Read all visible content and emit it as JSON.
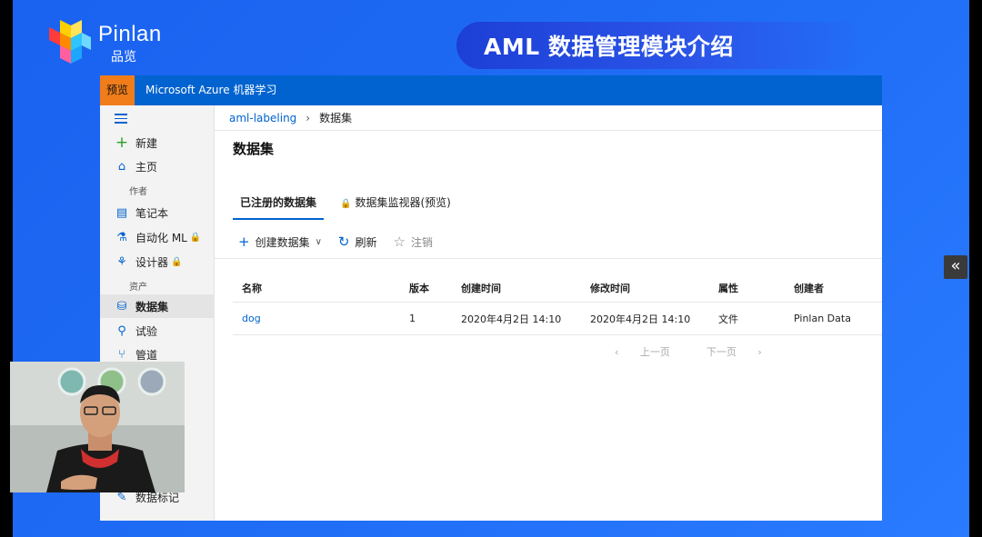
{
  "slide": {
    "logo_text": "Pinlan",
    "logo_sub": "品览",
    "title": "AML 数据管理模块介绍",
    "collapse_glyph": "«"
  },
  "app": {
    "preview_tag": "预览",
    "title": "Microsoft Azure 机器学习",
    "colors": {
      "topbar": "#0063cf",
      "preview": "#f07d1a",
      "accent": "#0063cf"
    }
  },
  "sidebar": {
    "items": [
      {
        "label": "新建",
        "icon": "plus-icon"
      },
      {
        "label": "主页",
        "icon": "home-icon"
      },
      {
        "label": "笔记本",
        "icon": "notebook-icon"
      },
      {
        "label": "自动化 ML",
        "icon": "automl-icon",
        "locked": true
      },
      {
        "label": "设计器",
        "icon": "designer-icon",
        "locked": true
      },
      {
        "label": "数据集",
        "icon": "dataset-icon",
        "active": true
      },
      {
        "label": "试验",
        "icon": "flask-icon"
      },
      {
        "label": "管道",
        "icon": "pipeline-icon"
      },
      {
        "label": "数据标记",
        "icon": "labeling-icon"
      }
    ],
    "sections": {
      "author": "作者",
      "assets": "资产"
    }
  },
  "breadcrumb": {
    "workspace": "aml-labeling",
    "current": "数据集"
  },
  "page": {
    "title": "数据集",
    "tabs": [
      {
        "label": "已注册的数据集",
        "active": true
      },
      {
        "label": "数据集监视器(预览)",
        "locked": true
      }
    ],
    "toolbar": {
      "create": "创建数据集",
      "refresh": "刷新",
      "unregister": "注销"
    },
    "table": {
      "headers": [
        "名称",
        "版本",
        "创建时间",
        "修改时间",
        "属性",
        "创建者"
      ],
      "rows": [
        [
          "dog",
          "1",
          "2020年4月2日 14:10",
          "2020年4月2日 14:10",
          "文件",
          "Pinlan Data"
        ]
      ]
    },
    "pager": {
      "prev": "上一页",
      "next": "下一页"
    }
  }
}
